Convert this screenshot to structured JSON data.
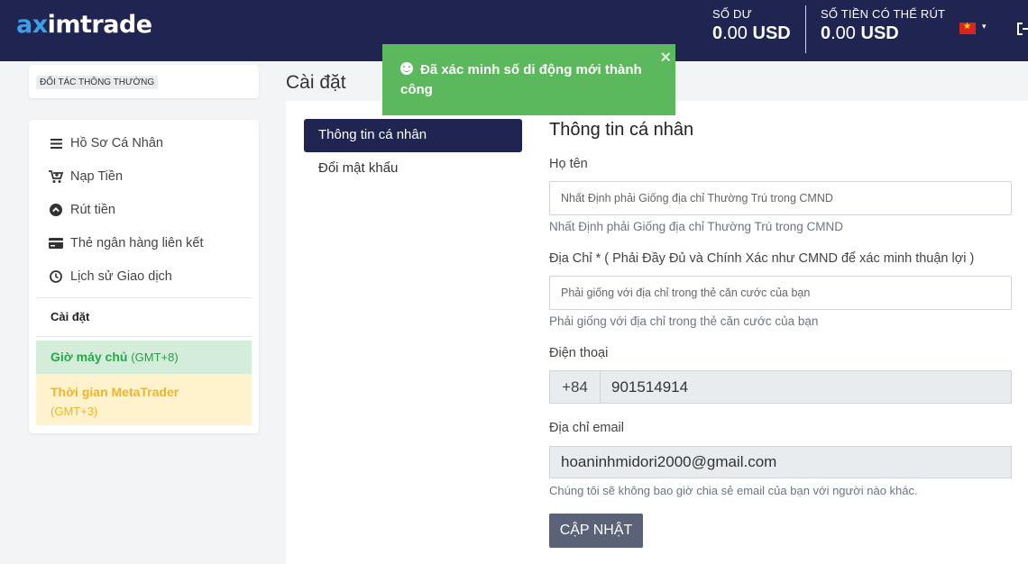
{
  "header": {
    "logo_prefix": "ax",
    "logo_rest": "imtrade",
    "balance": {
      "label": "SỐ DƯ",
      "int": "0",
      "dec": ".00",
      "currency": "USD"
    },
    "withdrawable": {
      "label": "SỐ TIỀN CÓ THỂ RÚT",
      "int": "0",
      "dec": ".00",
      "currency": "USD"
    },
    "language_flag": "vietnam-flag-icon",
    "caret": "▾"
  },
  "sidebar": {
    "partner_badge": "ĐỐI TÁC THÔNG THƯỜNG",
    "items": [
      {
        "label": "Hồ Sơ Cá Nhân",
        "icon": "list-icon"
      },
      {
        "label": "Nạp Tiền",
        "icon": "cart-icon"
      },
      {
        "label": "Rút tiền",
        "icon": "chevron-up-circle-icon"
      },
      {
        "label": "Thẻ ngân hàng liên kết",
        "icon": "credit-card-icon"
      },
      {
        "label": "Lịch sử Giao dịch",
        "icon": "clock-icon"
      }
    ],
    "settings_label": "Cài đặt",
    "server_time": {
      "label": "Giờ máy chủ",
      "tz": "(GMT+8)"
    },
    "metatrader_time": {
      "label": "Thời gian MetaTrader",
      "tz": "(GMT+3)"
    }
  },
  "main": {
    "page_title": "Cài đặt",
    "tabs": [
      {
        "label": "Thông tin cá nhân",
        "active": true
      },
      {
        "label": "Đổi mật khẩu",
        "active": false
      }
    ],
    "section_title": "Thông tin cá nhân",
    "fullname": {
      "label": "Họ tên",
      "placeholder": "Nhất Định phải Giống địa chỉ Thường Trú trong CMND",
      "help": "Nhất Định phải Giống địa chỉ Thường Trú trong CMND"
    },
    "address": {
      "label": "Địa Chỉ * ( Phải Đầy Đủ và Chính Xác như CMND để xác minh thuận lợi )",
      "placeholder": "Phải giống với địa chỉ trong thẻ căn cước của bạn",
      "help": "Phải giống với địa chỉ trong thẻ căn cước của bạn"
    },
    "phone": {
      "label": "Điện thoại",
      "prefix": "+84",
      "value": "901514914"
    },
    "email": {
      "label": "Địa chỉ email",
      "value": "hoaninhmidori2000@gmail.com",
      "help": "Chúng tôi sẽ không bao giờ chia sẻ email của bạn với người nào khác."
    },
    "submit_label": "CẬP NHẬT"
  },
  "toast": {
    "message": "Đã xác minh số di động mới thành công",
    "close": "×"
  },
  "colors": {
    "header_bg": "#1f2550",
    "logo_accent": "#3aa0e8",
    "toast_bg": "#5cb85c",
    "server_time_bg": "#d4edda",
    "metatrader_bg": "#fff3cd"
  }
}
